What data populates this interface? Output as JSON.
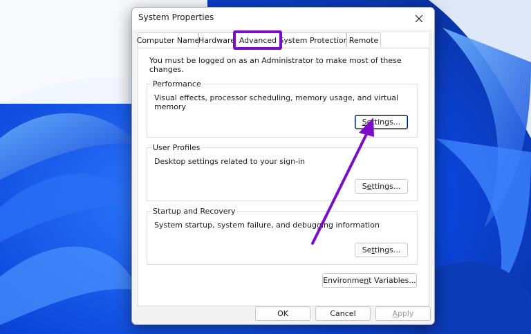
{
  "window": {
    "title": "System Properties",
    "close_glyph": "✕"
  },
  "tabs": [
    {
      "label": "Computer Name",
      "active": false
    },
    {
      "label": "Hardware",
      "active": false
    },
    {
      "label": "Advanced",
      "active": true
    },
    {
      "label": "System Protection",
      "active": false
    },
    {
      "label": "Remote",
      "active": false
    }
  ],
  "advanced": {
    "admin_note": "You must be logged on as an Administrator to make most of these changes.",
    "performance": {
      "title": "Performance",
      "description": "Visual effects, processor scheduling, memory usage, and virtual memory",
      "button": {
        "pre": "",
        "mnemonic": "S",
        "post": "ettings..."
      }
    },
    "user_profiles": {
      "title": "User Profiles",
      "description": "Desktop settings related to your sign-in",
      "button": {
        "pre": "S",
        "mnemonic": "e",
        "post": "ttings..."
      }
    },
    "startup_recovery": {
      "title": "Startup and Recovery",
      "description": "System startup, system failure, and debugging information",
      "button": {
        "pre": "Se",
        "mnemonic": "t",
        "post": "tings..."
      }
    },
    "env_vars_button": {
      "pre": "Environme",
      "mnemonic": "n",
      "post": "t Variables..."
    }
  },
  "footer": {
    "ok": "OK",
    "cancel": "Cancel",
    "apply": {
      "pre": "",
      "mnemonic": "A",
      "post": "pply"
    }
  },
  "colors": {
    "highlight": "#7a0ec8",
    "arrow": "#7a0ec8",
    "wallpaper": "#0a3dd1"
  }
}
